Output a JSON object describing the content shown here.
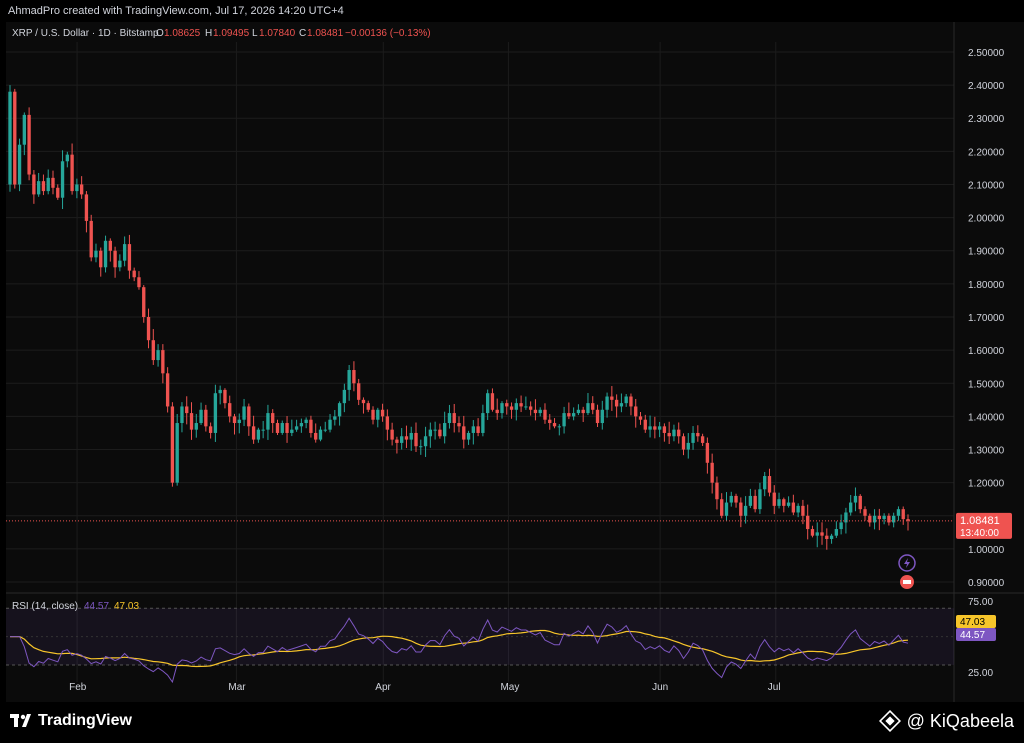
{
  "topbar": {
    "text": "AhmadPro created with TradingView.com, Jul 17, 2026 14:20 UTC+4"
  },
  "legend": {
    "symbol": "XRP / U.S. Dollar · 1D · Bitstamp",
    "o_label": "O",
    "o_value": "1.08625",
    "h_label": "H",
    "h_value": "1.09495",
    "l_label": "L",
    "l_value": "1.07840",
    "c_label": "C",
    "c_value": "1.08481",
    "change": "−0.00136 (−0.13%)"
  },
  "price_badge": {
    "value": "1.08481",
    "countdown": "13:40:00"
  },
  "rsi_legend": {
    "label": "RSI (14, close)",
    "rsi_value": "44.57",
    "ma_value": "47.03"
  },
  "rsi_badges": {
    "ma": "47.03",
    "rsi": "44.57"
  },
  "footer": {
    "logo_text": "TradingView",
    "brand_text": "@ KiQabeela"
  },
  "colors": {
    "up": "#26a69a",
    "down": "#ef5350",
    "rsi_line": "#7e57c2",
    "rsi_ma": "#f7c52a",
    "badge": "#ef5350",
    "grid": "#1c1c1c",
    "text": "#d1d4dc"
  },
  "chart_data": {
    "type": "candlestick",
    "title": "XRP / U.S. Dollar · 1D · Bitstamp",
    "y_ticks": [
      "2.50000",
      "2.40000",
      "2.30000",
      "2.20000",
      "2.10000",
      "2.00000",
      "1.90000",
      "1.80000",
      "1.70000",
      "1.60000",
      "1.50000",
      "1.40000",
      "1.30000",
      "1.20000",
      "1.10000",
      "1.00000",
      "0.90000"
    ],
    "y_tick_values": [
      2.5,
      2.4,
      2.3,
      2.2,
      2.1,
      2.0,
      1.9,
      1.8,
      1.7,
      1.6,
      1.5,
      1.4,
      1.3,
      1.2,
      1.1,
      1.0,
      0.9
    ],
    "ylim": [
      0.87,
      2.53
    ],
    "x_ticks": [
      "Feb",
      "Mar",
      "Apr",
      "May",
      "Jun",
      "Jul"
    ],
    "x_tick_positions": [
      0.075,
      0.243,
      0.398,
      0.53,
      0.69,
      0.812
    ],
    "last_price": 1.08481,
    "closes": [
      2.38,
      2.1,
      2.22,
      2.31,
      2.13,
      2.07,
      2.11,
      2.08,
      2.12,
      2.09,
      2.06,
      2.17,
      2.19,
      2.08,
      2.1,
      2.07,
      1.99,
      1.88,
      1.9,
      1.85,
      1.93,
      1.9,
      1.85,
      1.87,
      1.92,
      1.84,
      1.82,
      1.79,
      1.7,
      1.63,
      1.57,
      1.6,
      1.53,
      1.43,
      1.2,
      1.38,
      1.43,
      1.41,
      1.36,
      1.38,
      1.42,
      1.37,
      1.35,
      1.47,
      1.48,
      1.44,
      1.4,
      1.38,
      1.39,
      1.43,
      1.37,
      1.33,
      1.36,
      1.36,
      1.41,
      1.38,
      1.35,
      1.38,
      1.35,
      1.36,
      1.37,
      1.38,
      1.39,
      1.35,
      1.33,
      1.36,
      1.36,
      1.39,
      1.4,
      1.44,
      1.48,
      1.54,
      1.5,
      1.45,
      1.44,
      1.42,
      1.39,
      1.42,
      1.4,
      1.36,
      1.33,
      1.32,
      1.34,
      1.33,
      1.35,
      1.31,
      1.31,
      1.34,
      1.36,
      1.36,
      1.34,
      1.38,
      1.41,
      1.38,
      1.37,
      1.33,
      1.35,
      1.37,
      1.35,
      1.41,
      1.47,
      1.42,
      1.41,
      1.44,
      1.43,
      1.42,
      1.44,
      1.43,
      1.43,
      1.42,
      1.41,
      1.42,
      1.39,
      1.38,
      1.37,
      1.37,
      1.41,
      1.4,
      1.41,
      1.42,
      1.41,
      1.44,
      1.42,
      1.38,
      1.42,
      1.46,
      1.45,
      1.43,
      1.44,
      1.46,
      1.43,
      1.4,
      1.39,
      1.36,
      1.37,
      1.36,
      1.37,
      1.35,
      1.34,
      1.36,
      1.34,
      1.3,
      1.32,
      1.35,
      1.34,
      1.32,
      1.26,
      1.2,
      1.15,
      1.1,
      1.14,
      1.16,
      1.14,
      1.1,
      1.13,
      1.16,
      1.12,
      1.18,
      1.22,
      1.17,
      1.13,
      1.15,
      1.13,
      1.14,
      1.11,
      1.13,
      1.1,
      1.06,
      1.04,
      1.05,
      1.04,
      1.03,
      1.04,
      1.06,
      1.08,
      1.11,
      1.14,
      1.16,
      1.12,
      1.1,
      1.08,
      1.1,
      1.09,
      1.1,
      1.08,
      1.1,
      1.12,
      1.09,
      1.085
    ],
    "rsi": {
      "ylim": [
        18,
        80
      ],
      "ticks": [
        "75.00",
        "25.00"
      ],
      "upper": 70,
      "lower": 30,
      "mid": 50,
      "last_rsi": 44.57,
      "last_ma": 47.03
    }
  }
}
